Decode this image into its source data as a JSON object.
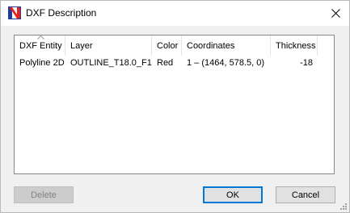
{
  "window": {
    "title": "DXF Description",
    "app_icon": "app-logo-icon",
    "close_icon": "close-icon"
  },
  "table": {
    "sort_icon": "sort-ascending-icon",
    "columns": [
      "DXF Entity",
      "Layer",
      "Color",
      "Coordinates",
      "Thickness"
    ],
    "rows": [
      [
        "Polyline 2D",
        "OUTLINE_T18.0_F1",
        "Red",
        "1 – (1464, 578.5, 0)",
        "-18"
      ]
    ]
  },
  "buttons": {
    "delete_label": "Delete",
    "ok_label": "OK",
    "cancel_label": "Cancel"
  },
  "colors": {
    "accent": "#0078d7",
    "logo_red": "#e8211a",
    "logo_blue": "#1f3d9e"
  }
}
